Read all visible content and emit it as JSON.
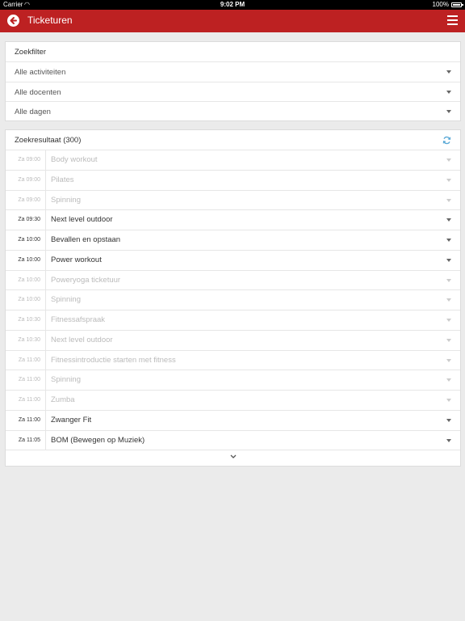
{
  "status": {
    "carrier": "Carrier",
    "time": "9:02 PM",
    "battery": "100%"
  },
  "topbar": {
    "title": "Ticketuren"
  },
  "filter": {
    "title": "Zoekfilter",
    "rows": [
      "Alle activiteiten",
      "Alle docenten",
      "Alle dagen"
    ]
  },
  "results": {
    "title": "Zoekresultaat (300)",
    "rows": [
      {
        "time": "Za 09:00",
        "name": "Body workout",
        "disabled": true
      },
      {
        "time": "Za 09:00",
        "name": "Pilates",
        "disabled": true
      },
      {
        "time": "Za 09:00",
        "name": "Spinning",
        "disabled": true
      },
      {
        "time": "Za 09:30",
        "name": "Next level outdoor",
        "disabled": false
      },
      {
        "time": "Za 10:00",
        "name": "Bevallen en opstaan",
        "disabled": false
      },
      {
        "time": "Za 10:00",
        "name": "Power workout",
        "disabled": false
      },
      {
        "time": "Za 10:00",
        "name": "Poweryoga ticketuur",
        "disabled": true
      },
      {
        "time": "Za 10:00",
        "name": "Spinning",
        "disabled": true
      },
      {
        "time": "Za 10:30",
        "name": "Fitnessafspraak",
        "disabled": true
      },
      {
        "time": "Za 10:30",
        "name": "Next level outdoor",
        "disabled": true
      },
      {
        "time": "Za 11:00",
        "name": "Fitnessintroductie starten met fitness",
        "disabled": true
      },
      {
        "time": "Za 11:00",
        "name": "Spinning",
        "disabled": true
      },
      {
        "time": "Za 11:00",
        "name": "Zumba",
        "disabled": true
      },
      {
        "time": "Za 11:00",
        "name": "Zwanger Fit",
        "disabled": false
      },
      {
        "time": "Za 11:05",
        "name": "BOM (Bewegen op Muziek)",
        "disabled": false
      }
    ]
  },
  "colors": {
    "accent": "#bd2122",
    "refresh": "#5aa9d6"
  }
}
